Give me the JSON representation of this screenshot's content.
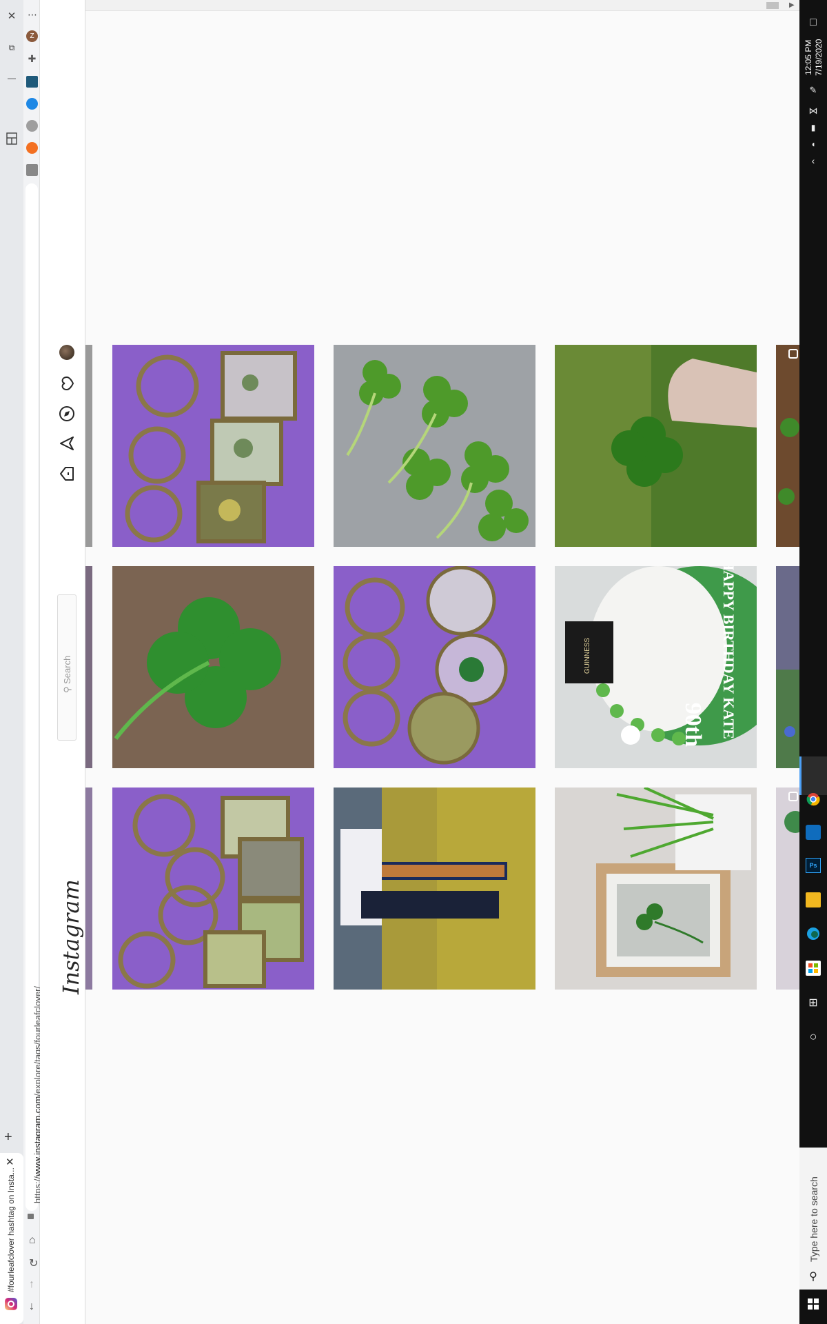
{
  "browser": {
    "tab_title": "#fourleafclover hashtag on Insta...",
    "url_prefix": "https://",
    "url_host": "www.instagram.com",
    "url_path": "/explore/tags/fourleafclover/",
    "new_tab": "+",
    "close": "✕",
    "menu": "⋯"
  },
  "instagram": {
    "logo": "Instagram",
    "search_placeholder": "Search",
    "nav_icons": [
      "home-icon",
      "direct-icon",
      "explore-icon",
      "activity-icon",
      "profile-avatar"
    ]
  },
  "grid": {
    "rows": [
      [
        {
          "name": "clover-keychains-purple-square"
        },
        {
          "name": "three-leaf-clovers-on-fabric"
        },
        {
          "name": "hand-holding-clover"
        },
        {
          "name": "clover-partial",
          "multi": true
        }
      ],
      [
        {
          "name": "single-four-leaf-clover-on-wood"
        },
        {
          "name": "clover-keychains-round"
        },
        {
          "name": "guinness-birthday-cake"
        },
        {
          "name": "flowers-partial"
        }
      ],
      [
        {
          "name": "clover-keychains-square-yellow"
        },
        {
          "name": "person-sitting-on-rail"
        },
        {
          "name": "framed-clover-with-plant"
        },
        {
          "name": "partial-image",
          "multi": true
        }
      ]
    ],
    "cake_text": [
      "HAPPY BIRTHDAY KATE",
      "90th"
    ],
    "guinness_text": "GUINNESS"
  },
  "taskbar": {
    "time": "12:05 PM",
    "date": "7/19/2020",
    "search_placeholder": "Type here to search"
  }
}
